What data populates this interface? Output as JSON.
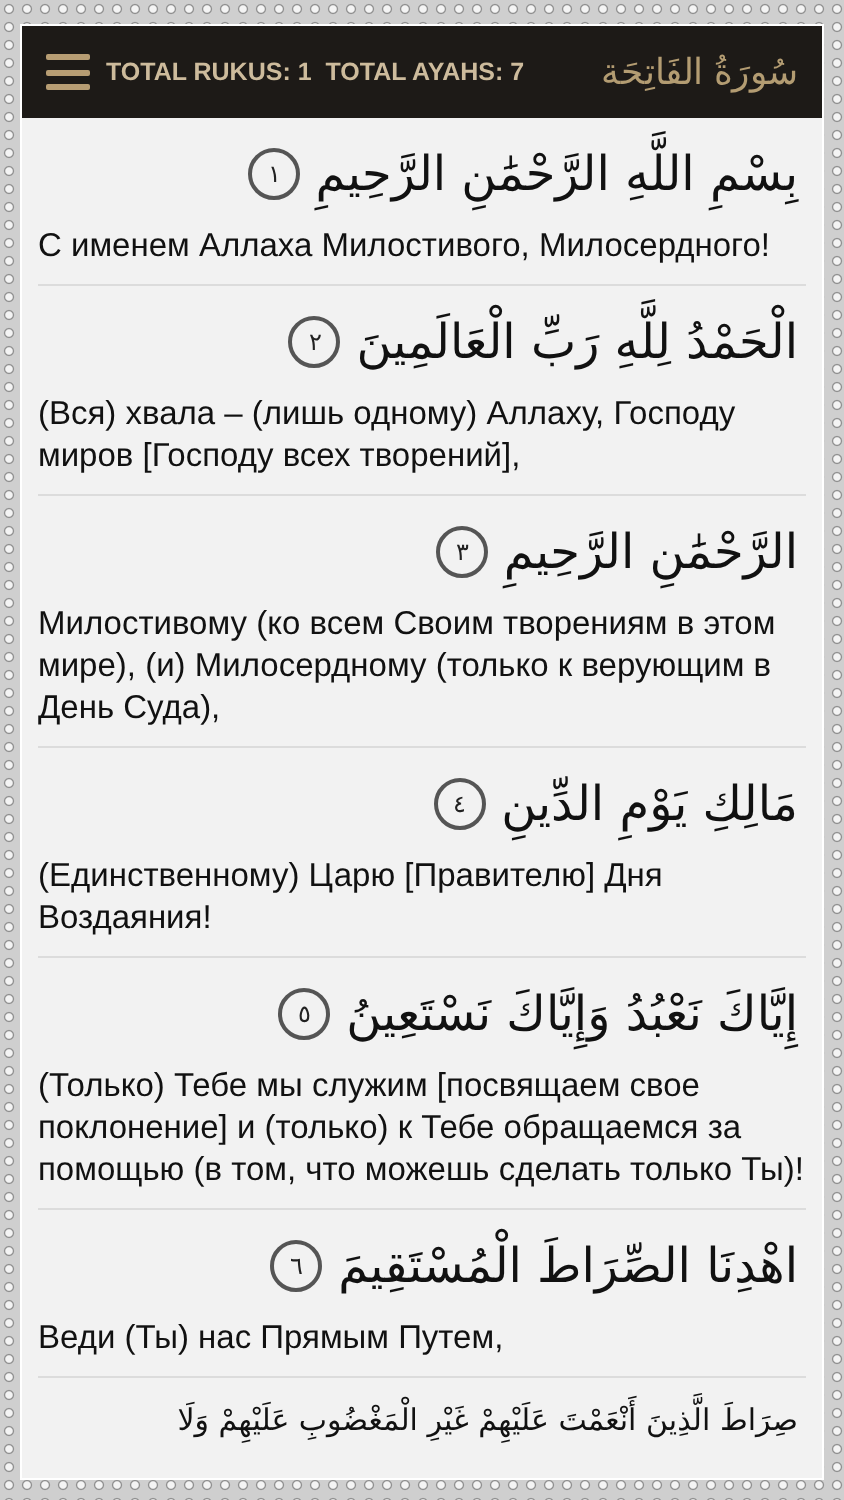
{
  "header": {
    "stats": "TOTAL RUKUS: 1  TOTAL AYAHS: 7",
    "title": "سُورَةُ الفَاتِحَة"
  },
  "verses": [
    {
      "arabic": "بِسْمِ اللَّهِ الرَّحْمَٰنِ الرَّحِيمِ",
      "number": "١",
      "translation": "С именем Аллаха Милостивого, Милосердного!"
    },
    {
      "arabic": "الْحَمْدُ لِلَّهِ رَبِّ الْعَالَمِينَ",
      "number": "٢",
      "translation": " (Вся) хвала – (лишь одному) Аллаху, Господу миров [Господу всех творений],"
    },
    {
      "arabic": "الرَّحْمَٰنِ الرَّحِيمِ",
      "number": "٣",
      "translation": " Милостивому (ко всем Своим творениям в этом мире), (и) Милосердному (только к верующим в День Суда),"
    },
    {
      "arabic": "مَالِكِ يَوْمِ الدِّينِ",
      "number": "٤",
      "translation": " (Единственному) Царю [Правителю] Дня Воздаяния!"
    },
    {
      "arabic": "إِيَّاكَ نَعْبُدُ وَإِيَّاكَ نَسْتَعِينُ",
      "number": "٥",
      "translation": " (Только) Тебе мы служим [посвящаем свое поклонение] и (только) к Тебе обращаемся за помощью (в том, что можешь сделать только Ты)!"
    },
    {
      "arabic": "اهْدِنَا الصِّرَاطَ الْمُسْتَقِيمَ",
      "number": "٦",
      "translation": "Веди (Ты) нас Прямым Путем,"
    },
    {
      "arabic": "صِرَاطَ الَّذِينَ أَنْعَمْتَ عَلَيْهِمْ غَيْرِ الْمَغْضُوبِ عَلَيْهِمْ وَلَا"
    }
  ]
}
